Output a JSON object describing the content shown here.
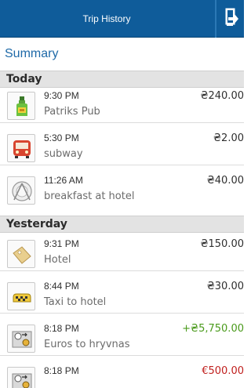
{
  "header": {
    "title": "Trip History",
    "logout_icon": "logout-door-icon",
    "accent_color": "#0f5c9a"
  },
  "summary": {
    "label": "Summary"
  },
  "sections": [
    {
      "title": "Today",
      "items": [
        {
          "time": "9:30 PM",
          "description": "Patriks Pub",
          "amount": "₴240.00",
          "icon": "bottle-icon"
        },
        {
          "time": "5:30 PM",
          "description": "subway",
          "amount": "₴2.00",
          "icon": "bus-icon"
        },
        {
          "time": "11:26 AM",
          "description": "breakfast at hotel",
          "amount": "₴40.00",
          "icon": "plate-icon"
        }
      ]
    },
    {
      "title": "Yesterday",
      "items": [
        {
          "time": "9:31 PM",
          "description": "Hotel",
          "amount": "₴150.00",
          "icon": "luggage-tag-icon"
        },
        {
          "time": "8:44 PM",
          "description": "Taxi to hotel",
          "amount": "₴30.00",
          "icon": "taxi-icon"
        },
        {
          "time": "8:18 PM",
          "description": "Euros to hryvnas",
          "amount": "+₴5,750.00",
          "icon": "currency-exchange-icon",
          "amount_color": "#4a9a1b"
        },
        {
          "time": "8:18 PM",
          "description": "",
          "amount": "€500.00",
          "icon": "currency-exchange-icon",
          "amount_color": "#c0201e"
        }
      ]
    }
  ]
}
